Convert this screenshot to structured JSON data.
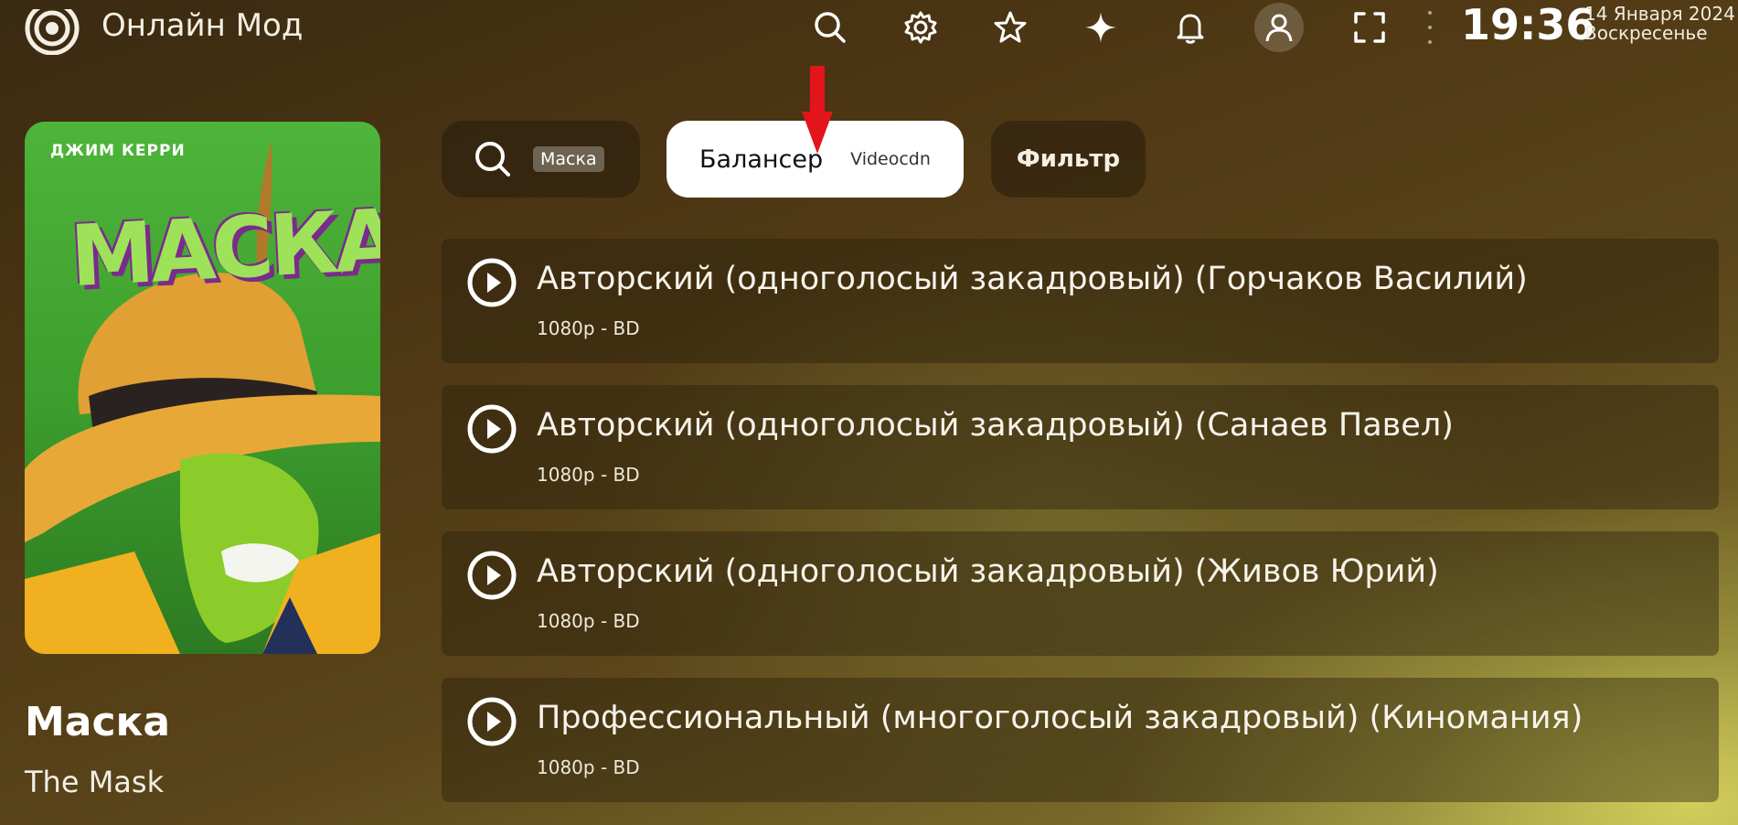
{
  "header": {
    "app_title": "Онлайн Мод",
    "icons": [
      "search-icon",
      "settings-icon",
      "star-icon",
      "sparkle-icon",
      "bell-icon",
      "user-icon",
      "fullscreen-icon",
      "more-icon"
    ],
    "time": "19:36",
    "date": "14 Января 2024",
    "weekday": "Воскресенье"
  },
  "poster": {
    "actor_text": "ДЖИМ КЕРРИ",
    "logo_text": "МАСКА"
  },
  "movie": {
    "title": "Маска",
    "original_title": "The Mask"
  },
  "toolbar": {
    "search_tag": "Маска",
    "balancer_label": "Балансер",
    "balancer_value": "Videocdn",
    "filter_label": "Фильтр"
  },
  "items": [
    {
      "name": "Авторский (одноголосый закадровый) (Горчаков Василий)",
      "quality": "1080p - BD"
    },
    {
      "name": "Авторский (одноголосый закадровый) (Санаев Павел)",
      "quality": "1080p - BD"
    },
    {
      "name": "Авторский (одноголосый закадровый) (Живов Юрий)",
      "quality": "1080p - BD"
    },
    {
      "name": "Профессиональный (многоголосый закадровый) (Киномания)",
      "quality": "1080p - BD"
    }
  ],
  "colors": {
    "accent_arrow": "#e3151b",
    "active_button_bg": "#ffffff"
  }
}
